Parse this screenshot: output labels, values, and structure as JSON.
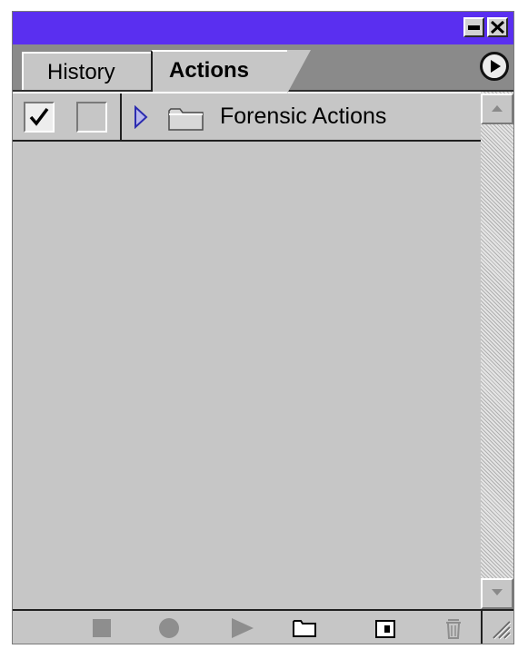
{
  "titlebar": {
    "minimize_icon": "minimize-icon",
    "close_icon": "close-icon",
    "color": "#5a2ff0"
  },
  "tabs": [
    {
      "label": "History",
      "active": false
    },
    {
      "label": "Actions",
      "active": true
    }
  ],
  "panel_menu_icon": "panel-menu-arrow-icon",
  "actions": [
    {
      "label": "Forensic Actions",
      "checked": true,
      "dialog_toggle": false,
      "expanded": false,
      "icon": "folder-icon"
    }
  ],
  "toolbar": {
    "buttons": [
      {
        "name": "stop",
        "icon": "stop-icon",
        "enabled": false
      },
      {
        "name": "record",
        "icon": "record-icon",
        "enabled": false
      },
      {
        "name": "play",
        "icon": "play-icon",
        "enabled": false
      },
      {
        "name": "new-set",
        "icon": "new-set-folder-icon",
        "enabled": true
      },
      {
        "name": "new-action",
        "icon": "new-action-icon",
        "enabled": true
      },
      {
        "name": "delete",
        "icon": "trash-icon",
        "enabled": false
      }
    ]
  }
}
